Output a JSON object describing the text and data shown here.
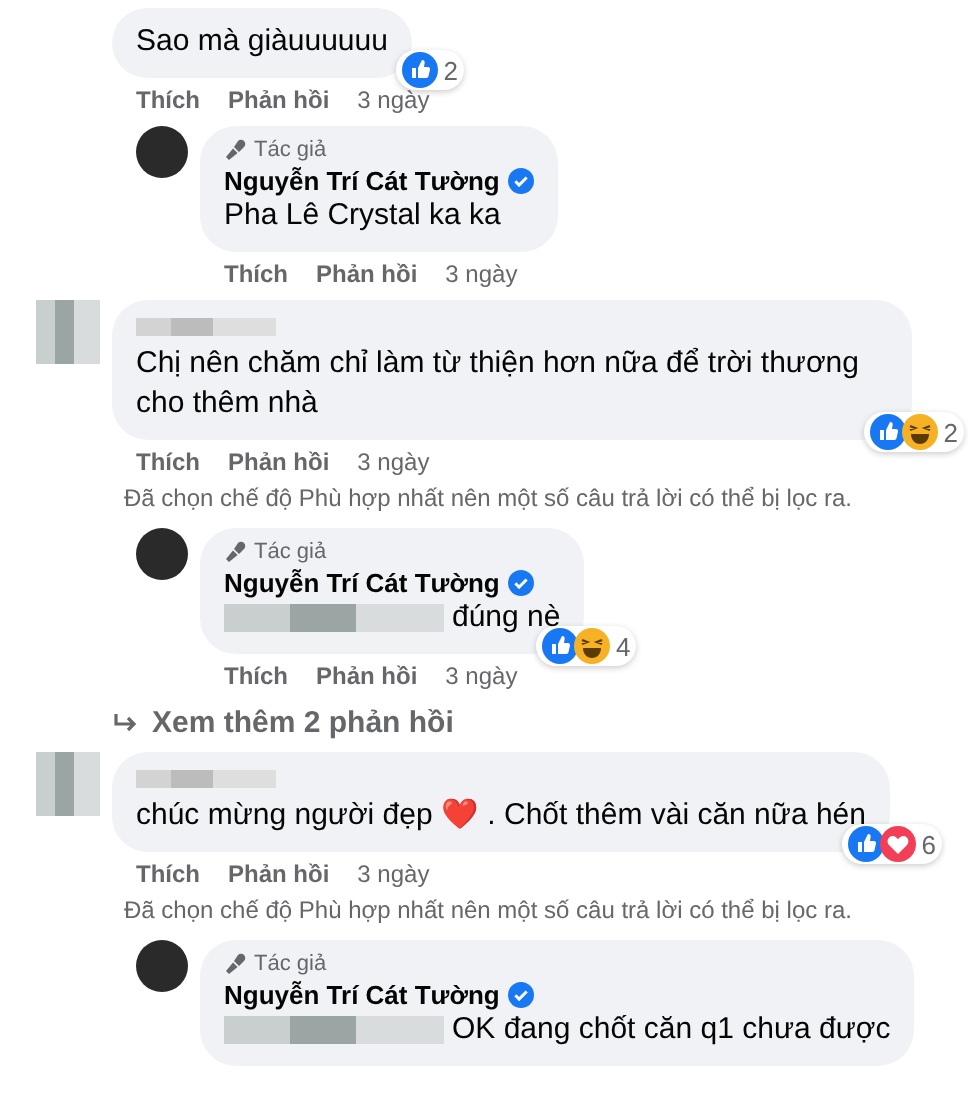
{
  "comments": [
    {
      "text": "Sao mà giàuuuuuu",
      "reactions": [
        {
          "kind": "like"
        }
      ],
      "reaction_count": "2",
      "actions": [
        "Thích",
        "Phản hồi"
      ],
      "time": "3 ngày",
      "replies": [
        {
          "badge": "Tác giả",
          "author": "Nguyễn Trí Cát Tường",
          "verified": true,
          "text": "Pha Lê Crystal ka ka",
          "actions": [
            "Thích",
            "Phản hồi"
          ],
          "time": "3 ngày"
        }
      ]
    },
    {
      "author_hidden": true,
      "text": "Chị nên chăm chỉ làm từ thiện hơn nữa để trời thương cho thêm nhà",
      "reactions": [
        {
          "kind": "like"
        },
        {
          "kind": "haha"
        }
      ],
      "reaction_count": "2",
      "actions": [
        "Thích",
        "Phản hồi"
      ],
      "time": "3 ngày",
      "filter_note": "Đã chọn chế độ Phù hợp nhất nên một số câu trả lời có thể bị lọc ra.",
      "replies": [
        {
          "badge": "Tác giả",
          "author": "Nguyễn Trí Cát Tường",
          "verified": true,
          "mention_hidden": true,
          "text": "đúng nè",
          "reactions": [
            {
              "kind": "like"
            },
            {
              "kind": "haha"
            }
          ],
          "reaction_count": "4",
          "actions": [
            "Thích",
            "Phản hồi"
          ],
          "time": "3 ngày"
        }
      ],
      "more_replies": "Xem thêm 2 phản hồi"
    },
    {
      "author_hidden": true,
      "text": "chúc mừng người đẹp ❤️ . Chốt thêm vài căn nữa hén",
      "reactions": [
        {
          "kind": "like"
        },
        {
          "kind": "love"
        }
      ],
      "reaction_count": "6",
      "actions": [
        "Thích",
        "Phản hồi"
      ],
      "time": "3 ngày",
      "filter_note": "Đã chọn chế độ Phù hợp nhất nên một số câu trả lời có thể bị lọc ra.",
      "replies": [
        {
          "badge": "Tác giả",
          "author": "Nguyễn Trí Cát Tường",
          "verified": true,
          "mention_hidden": true,
          "text": "OK đang chốt căn q1 chưa được"
        }
      ]
    }
  ]
}
